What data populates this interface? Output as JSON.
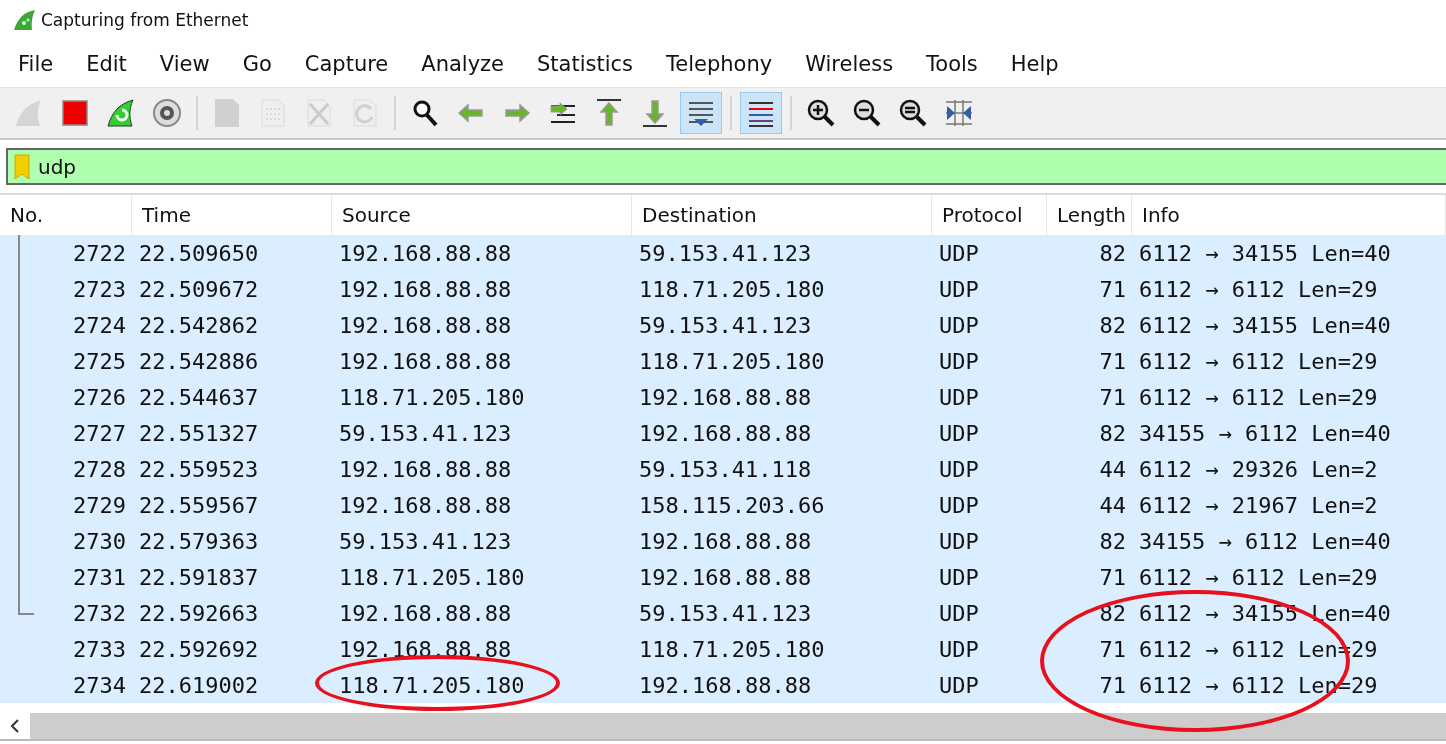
{
  "window": {
    "title": "Capturing from Ethernet"
  },
  "menu": [
    "File",
    "Edit",
    "View",
    "Go",
    "Capture",
    "Analyze",
    "Statistics",
    "Telephony",
    "Wireless",
    "Tools",
    "Help"
  ],
  "toolbar": [
    {
      "buttons": [
        {
          "kind": "start",
          "disabled": true,
          "selected": false
        },
        {
          "kind": "stop",
          "disabled": false,
          "selected": false
        },
        {
          "kind": "restart",
          "disabled": false,
          "selected": false
        },
        {
          "kind": "options",
          "disabled": false,
          "selected": false
        }
      ]
    },
    {
      "buttons": [
        {
          "kind": "open",
          "disabled": true,
          "selected": false
        },
        {
          "kind": "save",
          "disabled": true,
          "selected": false
        },
        {
          "kind": "close",
          "disabled": true,
          "selected": false
        },
        {
          "kind": "reload",
          "disabled": true,
          "selected": false
        }
      ]
    },
    {
      "buttons": [
        {
          "kind": "find",
          "disabled": false,
          "selected": false
        },
        {
          "kind": "back",
          "disabled": false,
          "selected": false
        },
        {
          "kind": "forward",
          "disabled": false,
          "selected": false
        },
        {
          "kind": "goto",
          "disabled": false,
          "selected": false
        },
        {
          "kind": "first",
          "disabled": false,
          "selected": false
        },
        {
          "kind": "last",
          "disabled": false,
          "selected": false
        },
        {
          "kind": "autoscroll",
          "disabled": false,
          "selected": true
        }
      ]
    },
    {
      "buttons": [
        {
          "kind": "colorize",
          "disabled": false,
          "selected": true
        }
      ]
    },
    {
      "buttons": [
        {
          "kind": "zoom-in",
          "disabled": false,
          "selected": false
        },
        {
          "kind": "zoom-out",
          "disabled": false,
          "selected": false
        },
        {
          "kind": "zoom-reset",
          "disabled": false,
          "selected": false
        },
        {
          "kind": "resize",
          "disabled": false,
          "selected": false
        }
      ]
    }
  ],
  "filter": {
    "value": "udp",
    "valid": true
  },
  "table": {
    "columns": [
      "No.",
      "Time",
      "Source",
      "Destination",
      "Protocol",
      "Length",
      "Info"
    ],
    "rows": [
      {
        "kind": "conversation",
        "cells": [
          "2722",
          "22.509650",
          "192.168.88.88",
          "59.153.41.123",
          "UDP",
          "82",
          "6112 → 34155 Len=40"
        ]
      },
      {
        "kind": "conversation",
        "cells": [
          "2723",
          "22.509672",
          "192.168.88.88",
          "118.71.205.180",
          "UDP",
          "71",
          "6112 → 6112 Len=29"
        ]
      },
      {
        "kind": "conversation",
        "cells": [
          "2724",
          "22.542862",
          "192.168.88.88",
          "59.153.41.123",
          "UDP",
          "82",
          "6112 → 34155 Len=40"
        ]
      },
      {
        "kind": "conversation",
        "cells": [
          "2725",
          "22.542886",
          "192.168.88.88",
          "118.71.205.180",
          "UDP",
          "71",
          "6112 → 6112 Len=29"
        ]
      },
      {
        "kind": "conversation",
        "cells": [
          "2726",
          "22.544637",
          "118.71.205.180",
          "192.168.88.88",
          "UDP",
          "71",
          "6112 → 6112 Len=29"
        ]
      },
      {
        "kind": "conversation",
        "cells": [
          "2727",
          "22.551327",
          "59.153.41.123",
          "192.168.88.88",
          "UDP",
          "82",
          "34155 → 6112 Len=40"
        ]
      },
      {
        "kind": "conversation",
        "cells": [
          "2728",
          "22.559523",
          "192.168.88.88",
          "59.153.41.118",
          "UDP",
          "44",
          "6112 → 29326 Len=2"
        ]
      },
      {
        "kind": "conversation",
        "cells": [
          "2729",
          "22.559567",
          "192.168.88.88",
          "158.115.203.66",
          "UDP",
          "44",
          "6112 → 21967 Len=2"
        ]
      },
      {
        "kind": "conversation",
        "cells": [
          "2730",
          "22.579363",
          "59.153.41.123",
          "192.168.88.88",
          "UDP",
          "82",
          "34155 → 6112 Len=40"
        ]
      },
      {
        "kind": "conversation",
        "cells": [
          "2731",
          "22.591837",
          "118.71.205.180",
          "192.168.88.88",
          "UDP",
          "71",
          "6112 → 6112 Len=29"
        ]
      },
      {
        "kind": "conversation-end",
        "cells": [
          "2732",
          "22.592663",
          "192.168.88.88",
          "59.153.41.123",
          "UDP",
          "82",
          "6112 → 34155 Len=40"
        ]
      },
      {
        "kind": "packet",
        "cells": [
          "2733",
          "22.592692",
          "192.168.88.88",
          "118.71.205.180",
          "UDP",
          "71",
          "6112 → 6112 Len=29"
        ]
      },
      {
        "kind": "packet",
        "cells": [
          "2734",
          "22.619002",
          "118.71.205.180",
          "192.168.88.88",
          "UDP",
          "71",
          "6112 → 6112 Len=29"
        ]
      }
    ]
  },
  "annotations": [
    {
      "kind": "ellipse",
      "color": "#e8101c"
    },
    {
      "kind": "ellipse",
      "color": "#e8101c"
    }
  ]
}
